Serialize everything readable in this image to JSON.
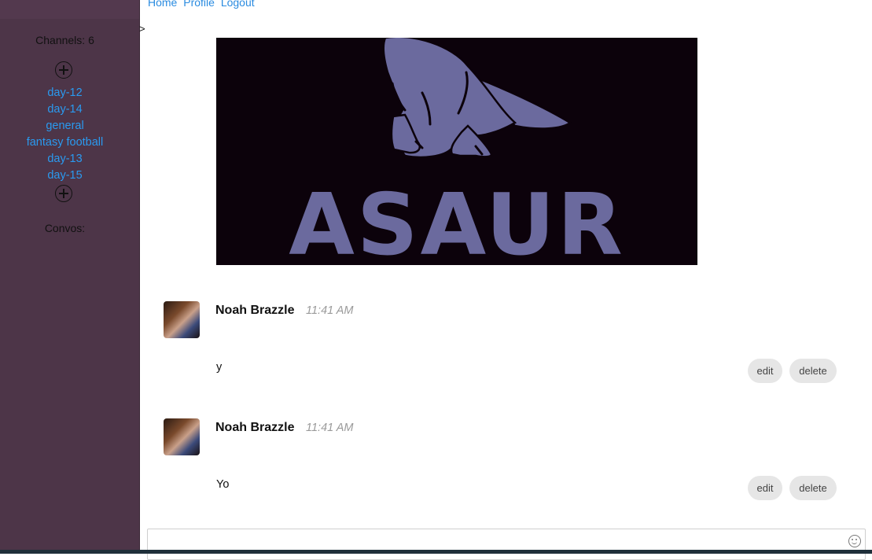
{
  "sidebar": {
    "channels_label": "Channels: 6",
    "channels": [
      "day-12",
      "day-14",
      "general",
      "fantasy football",
      "day-13",
      "day-15"
    ],
    "convos_label": "Convos:"
  },
  "nav": {
    "home": "Home",
    "profile": "Profile",
    "logout": "Logout",
    "caret": ">"
  },
  "banner": {
    "text": "ASAUR"
  },
  "messages": [
    {
      "author": "Noah Brazzle",
      "time": "11:41 AM",
      "text": "y",
      "edit": "edit",
      "delete": "delete"
    },
    {
      "author": "Noah Brazzle",
      "time": "11:41 AM",
      "text": "Yo",
      "edit": "edit",
      "delete": "delete"
    }
  ],
  "colors": {
    "sidebar": "#4d3548",
    "link": "#2a9af0",
    "dino": "#6b6a9e",
    "banner_bg": "#0c020b"
  }
}
